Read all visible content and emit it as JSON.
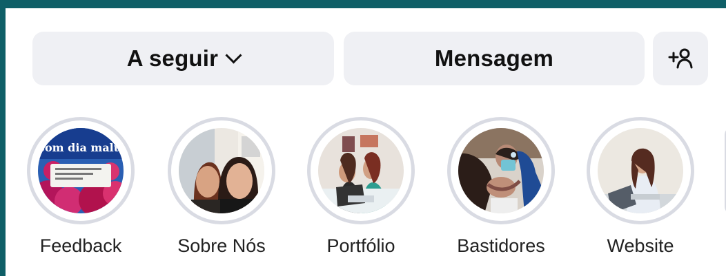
{
  "actions": {
    "follow_label": "A seguir",
    "message_label": "Mensagem",
    "add_person_icon": "add-person-icon"
  },
  "highlights": [
    {
      "label": "Feedback",
      "cover_text": "Bom dia malta",
      "cover_icon": "flowers-text-image"
    },
    {
      "label": "Sobre Nós",
      "cover_icon": "two-women-photo"
    },
    {
      "label": "Portfólio",
      "cover_icon": "laptop-team-photo"
    },
    {
      "label": "Bastidores",
      "cover_icon": "dental-clinic-photo"
    },
    {
      "label": "Website",
      "cover_icon": "woman-laptop-photo"
    }
  ],
  "colors": {
    "frame": "#0f5f67",
    "button_bg": "#eff0f4",
    "ring": "#d9dbe3",
    "text": "#111111"
  }
}
